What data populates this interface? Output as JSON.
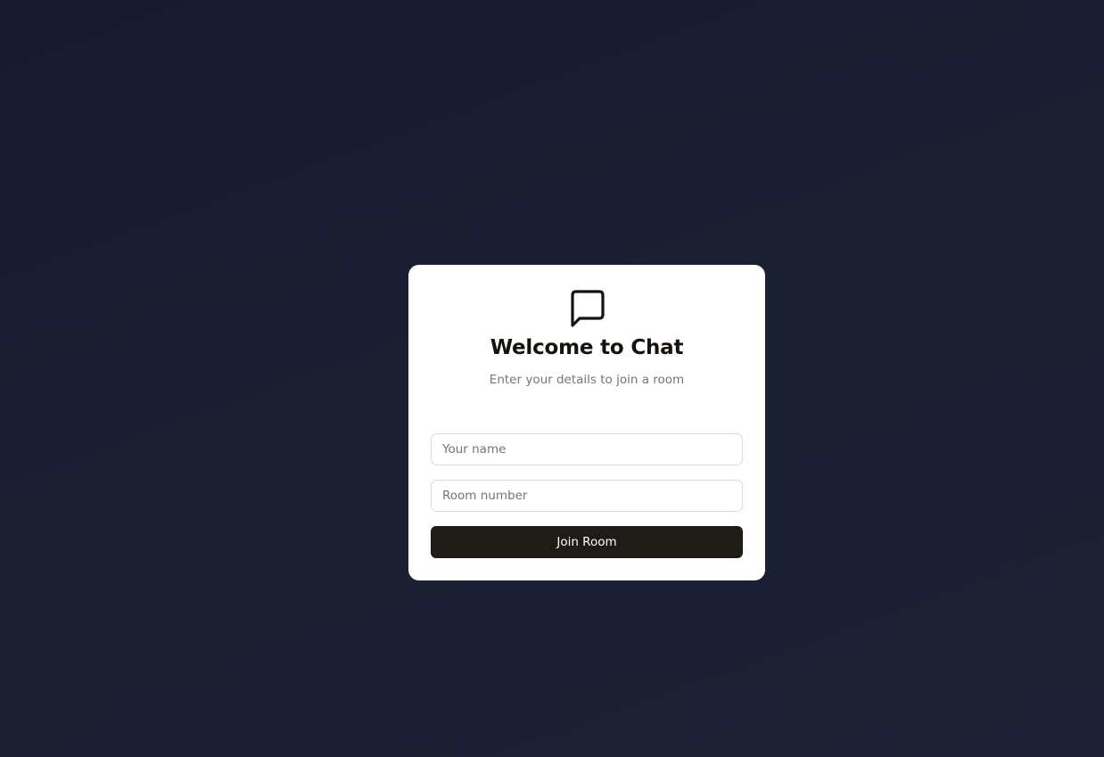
{
  "header": {
    "icon": "message-square-icon",
    "title": "Welcome to Chat",
    "subtitle": "Enter your details to join a room"
  },
  "form": {
    "name_placeholder": "Your name",
    "name_value": "",
    "room_placeholder": "Room number",
    "room_value": "",
    "join_label": "Join Room"
  },
  "colors": {
    "background": "#181c30",
    "card": "#ffffff",
    "button": "#1f1b17",
    "title_text": "#16130f",
    "muted_text": "#7a746d",
    "input_border": "#dcdad6"
  }
}
